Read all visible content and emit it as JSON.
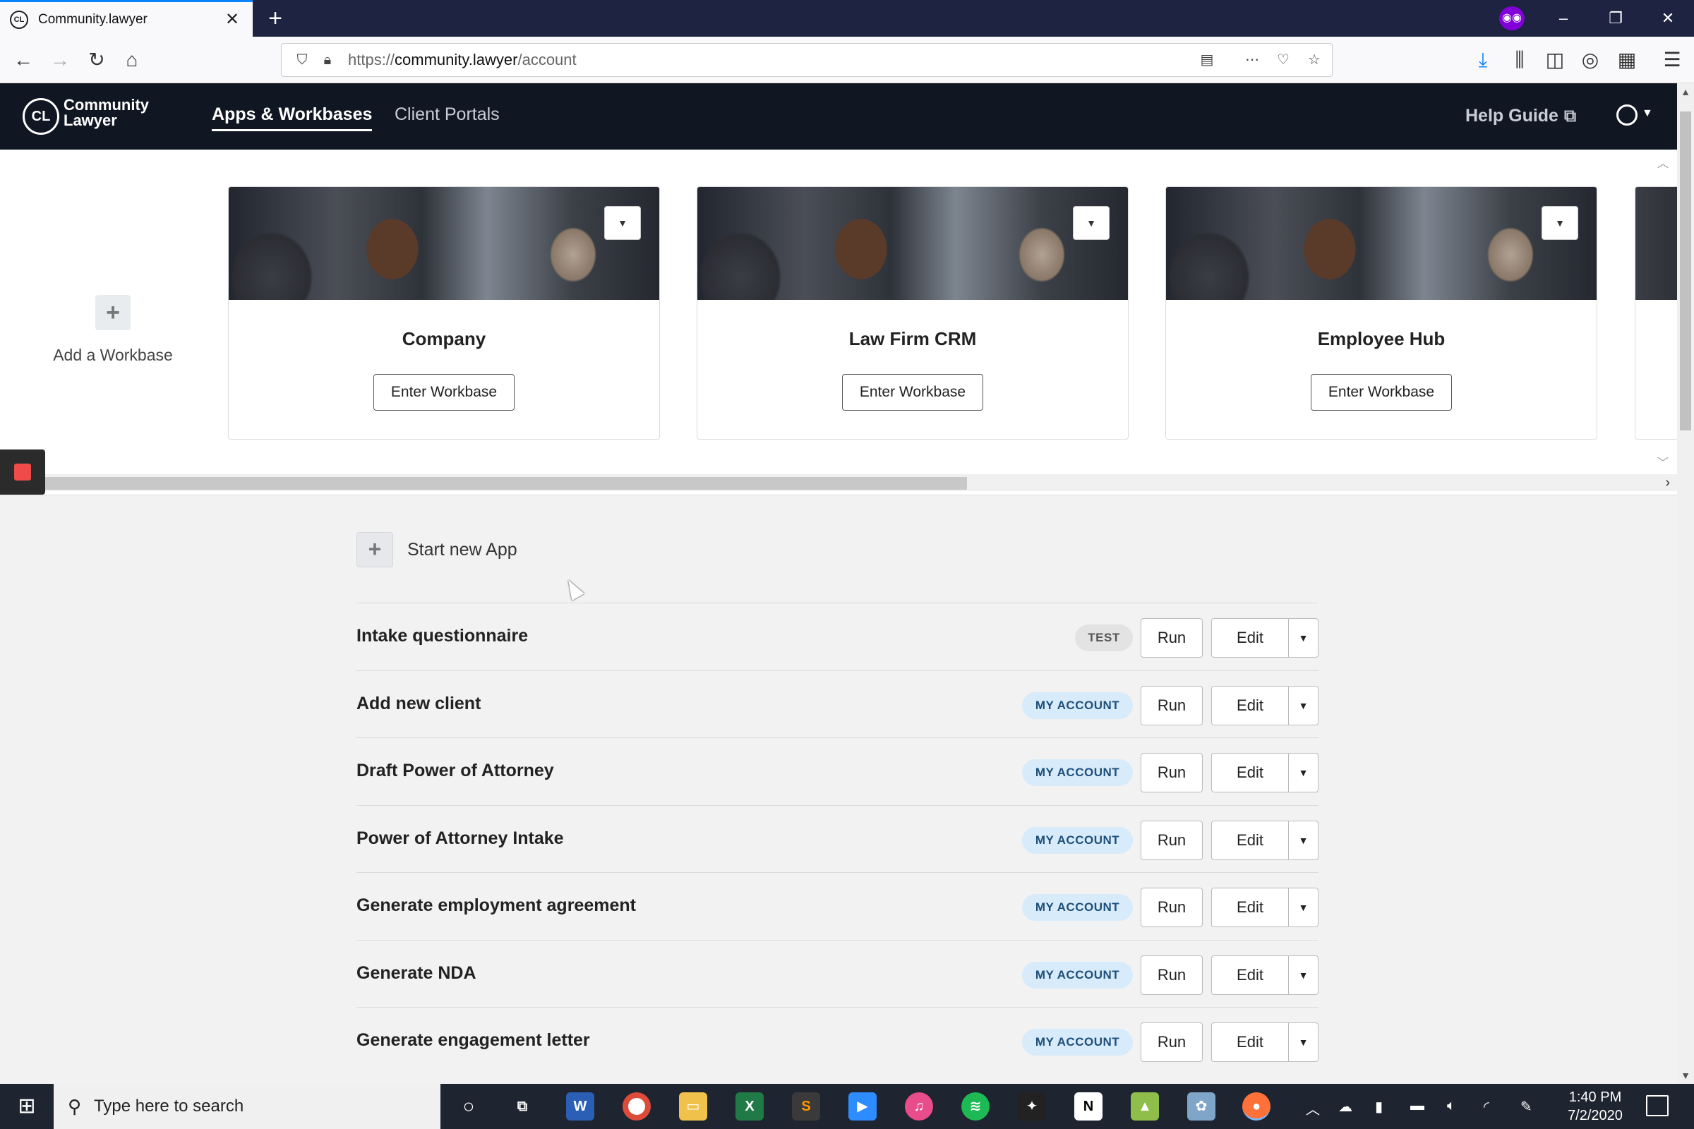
{
  "browser": {
    "tab_title": "Community.lawyer",
    "tab_favicon": "CL",
    "url_prefix": "https://",
    "url_host": "community.lawyer",
    "url_path": "/account"
  },
  "header": {
    "logo_mark": "CL",
    "logo_line1": "Community",
    "logo_line2": "Lawyer",
    "nav": [
      "Apps & Workbases",
      "Client Portals"
    ],
    "help_label": "Help Guide"
  },
  "workbases": {
    "add_label": "Add a Workbase",
    "enter_label": "Enter Workbase",
    "cards": [
      {
        "name": "Company"
      },
      {
        "name": "Law Firm CRM"
      },
      {
        "name": "Employee Hub"
      }
    ]
  },
  "apps": {
    "start_label": "Start new App",
    "run_label": "Run",
    "edit_label": "Edit",
    "rows": [
      {
        "name": "Intake questionnaire",
        "badge": "TEST"
      },
      {
        "name": "Add new client",
        "badge": "MY ACCOUNT"
      },
      {
        "name": "Draft Power of Attorney",
        "badge": "MY ACCOUNT"
      },
      {
        "name": "Power of Attorney Intake",
        "badge": "MY ACCOUNT"
      },
      {
        "name": "Generate employment agreement",
        "badge": "MY ACCOUNT"
      },
      {
        "name": "Generate NDA",
        "badge": "MY ACCOUNT"
      },
      {
        "name": "Generate engagement letter",
        "badge": "MY ACCOUNT"
      }
    ]
  },
  "taskbar": {
    "search_placeholder": "Type here to search",
    "time": "1:40 PM",
    "date": "7/2/2020"
  },
  "colors": {
    "header_bg": "#111722",
    "badge_account_bg": "#d7ebfa",
    "badge_test_bg": "#e3e3e3",
    "record_red": "#ef4b4b"
  }
}
